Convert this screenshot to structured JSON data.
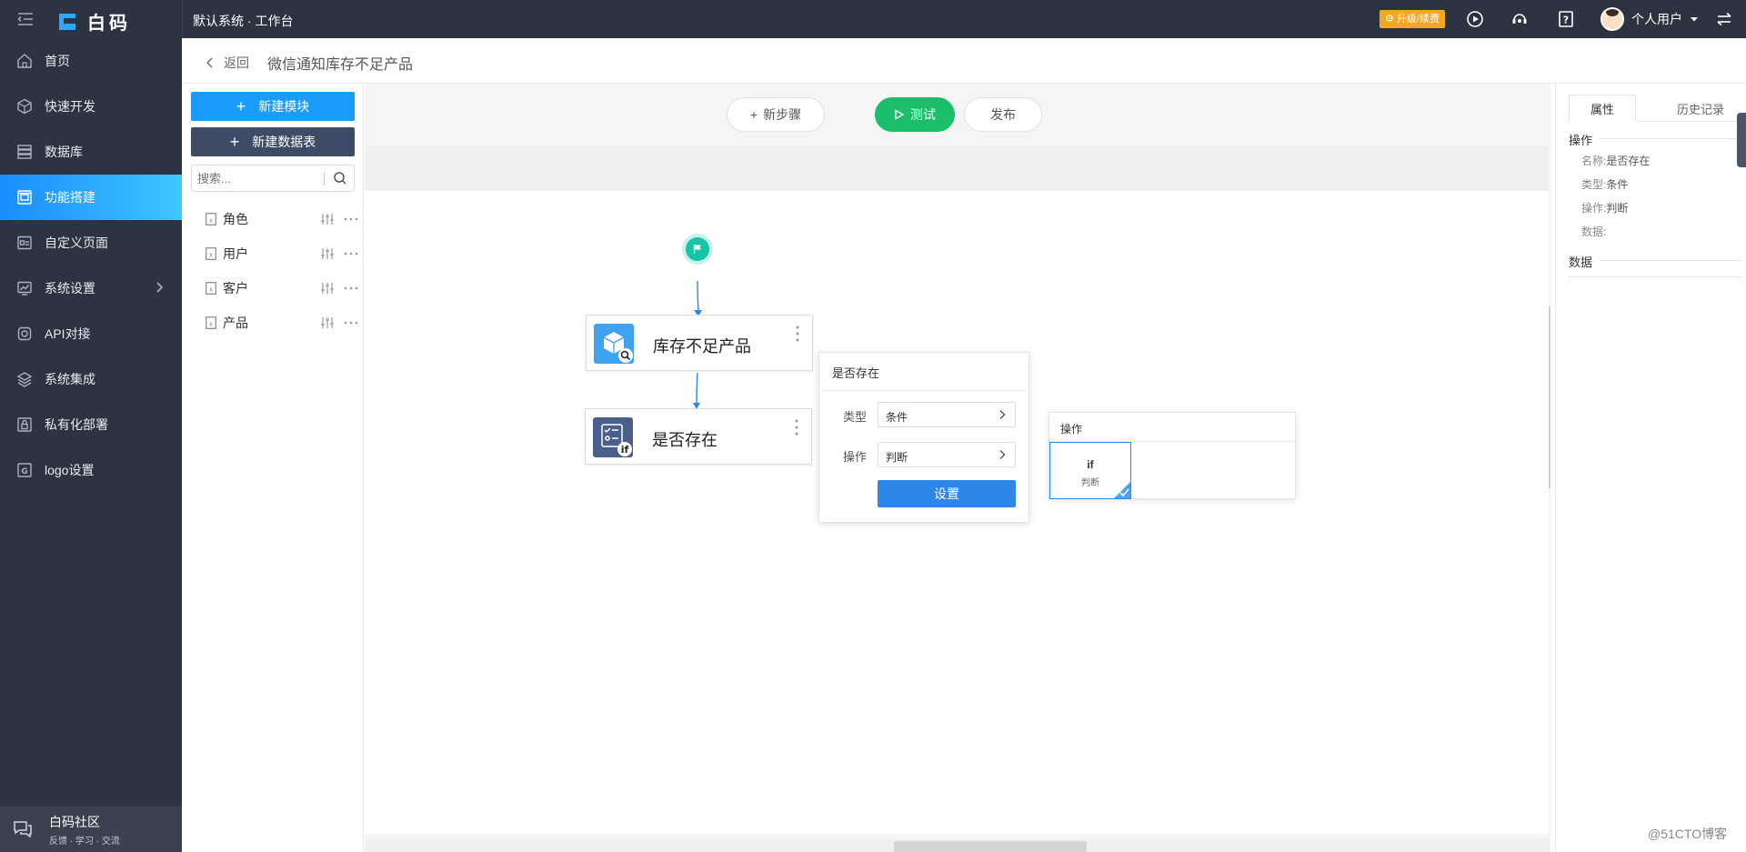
{
  "topbar": {
    "brand": "白码",
    "crumb": "默认系统 · 工作台",
    "upgrade": "升级/续费",
    "user_name": "个人用户"
  },
  "sidebar": {
    "items": [
      {
        "label": "首页",
        "icon": "home-icon"
      },
      {
        "label": "快速开发",
        "icon": "cube-icon"
      },
      {
        "label": "数据库",
        "icon": "database-icon"
      },
      {
        "label": "功能搭建",
        "icon": "build-icon",
        "active": true
      },
      {
        "label": "自定义页面",
        "icon": "page-icon"
      },
      {
        "label": "系统设置",
        "icon": "chart-settings-icon"
      },
      {
        "label": "API对接",
        "icon": "api-icon"
      },
      {
        "label": "系统集成",
        "icon": "layers-icon"
      },
      {
        "label": "私有化部署",
        "icon": "lock-icon"
      },
      {
        "label": "logo设置",
        "icon": "logo-icon"
      }
    ],
    "community_title": "白码社区",
    "community_sub": "反馈 · 学习 · 交流"
  },
  "header": {
    "back": "返回",
    "title": "微信通知库存不足产品"
  },
  "leftpanel": {
    "new_module": "新建模块",
    "new_table": "新建数据表",
    "search_placeholder": "搜索...",
    "tables": [
      "角色",
      "用户",
      "客户",
      "产品"
    ]
  },
  "toolbar": {
    "add_step": "新步骤",
    "test": "测试",
    "publish": "发布"
  },
  "flow": {
    "node1": "库存不足产品",
    "node2": "是否存在"
  },
  "popup": {
    "title": "是否存在",
    "type_label": "类型",
    "type_value": "条件",
    "op_label": "操作",
    "op_value": "判断",
    "button": "设置"
  },
  "oppanel": {
    "title": "操作",
    "card_symbol": "if",
    "card_label": "判断"
  },
  "rightpanel": {
    "tab_props": "属性",
    "tab_history": "历史记录",
    "section_op": "操作",
    "name_label": "名称:",
    "name_value": "是否存在",
    "type_label": "类型:",
    "type_value": "条件",
    "op_label": "操作:",
    "op_value": "判断",
    "data_label": "数据:",
    "section_data": "数据"
  },
  "watermark": "@51CTO博客",
  "colors": {
    "sidebar_bg": "#2c3341",
    "active_blue": "#1a8cff",
    "primary_button": "#1a9cff",
    "test_green": "#1bbf6b",
    "start_teal": "#16c4a7",
    "upgrade_orange": "#f5a623"
  }
}
